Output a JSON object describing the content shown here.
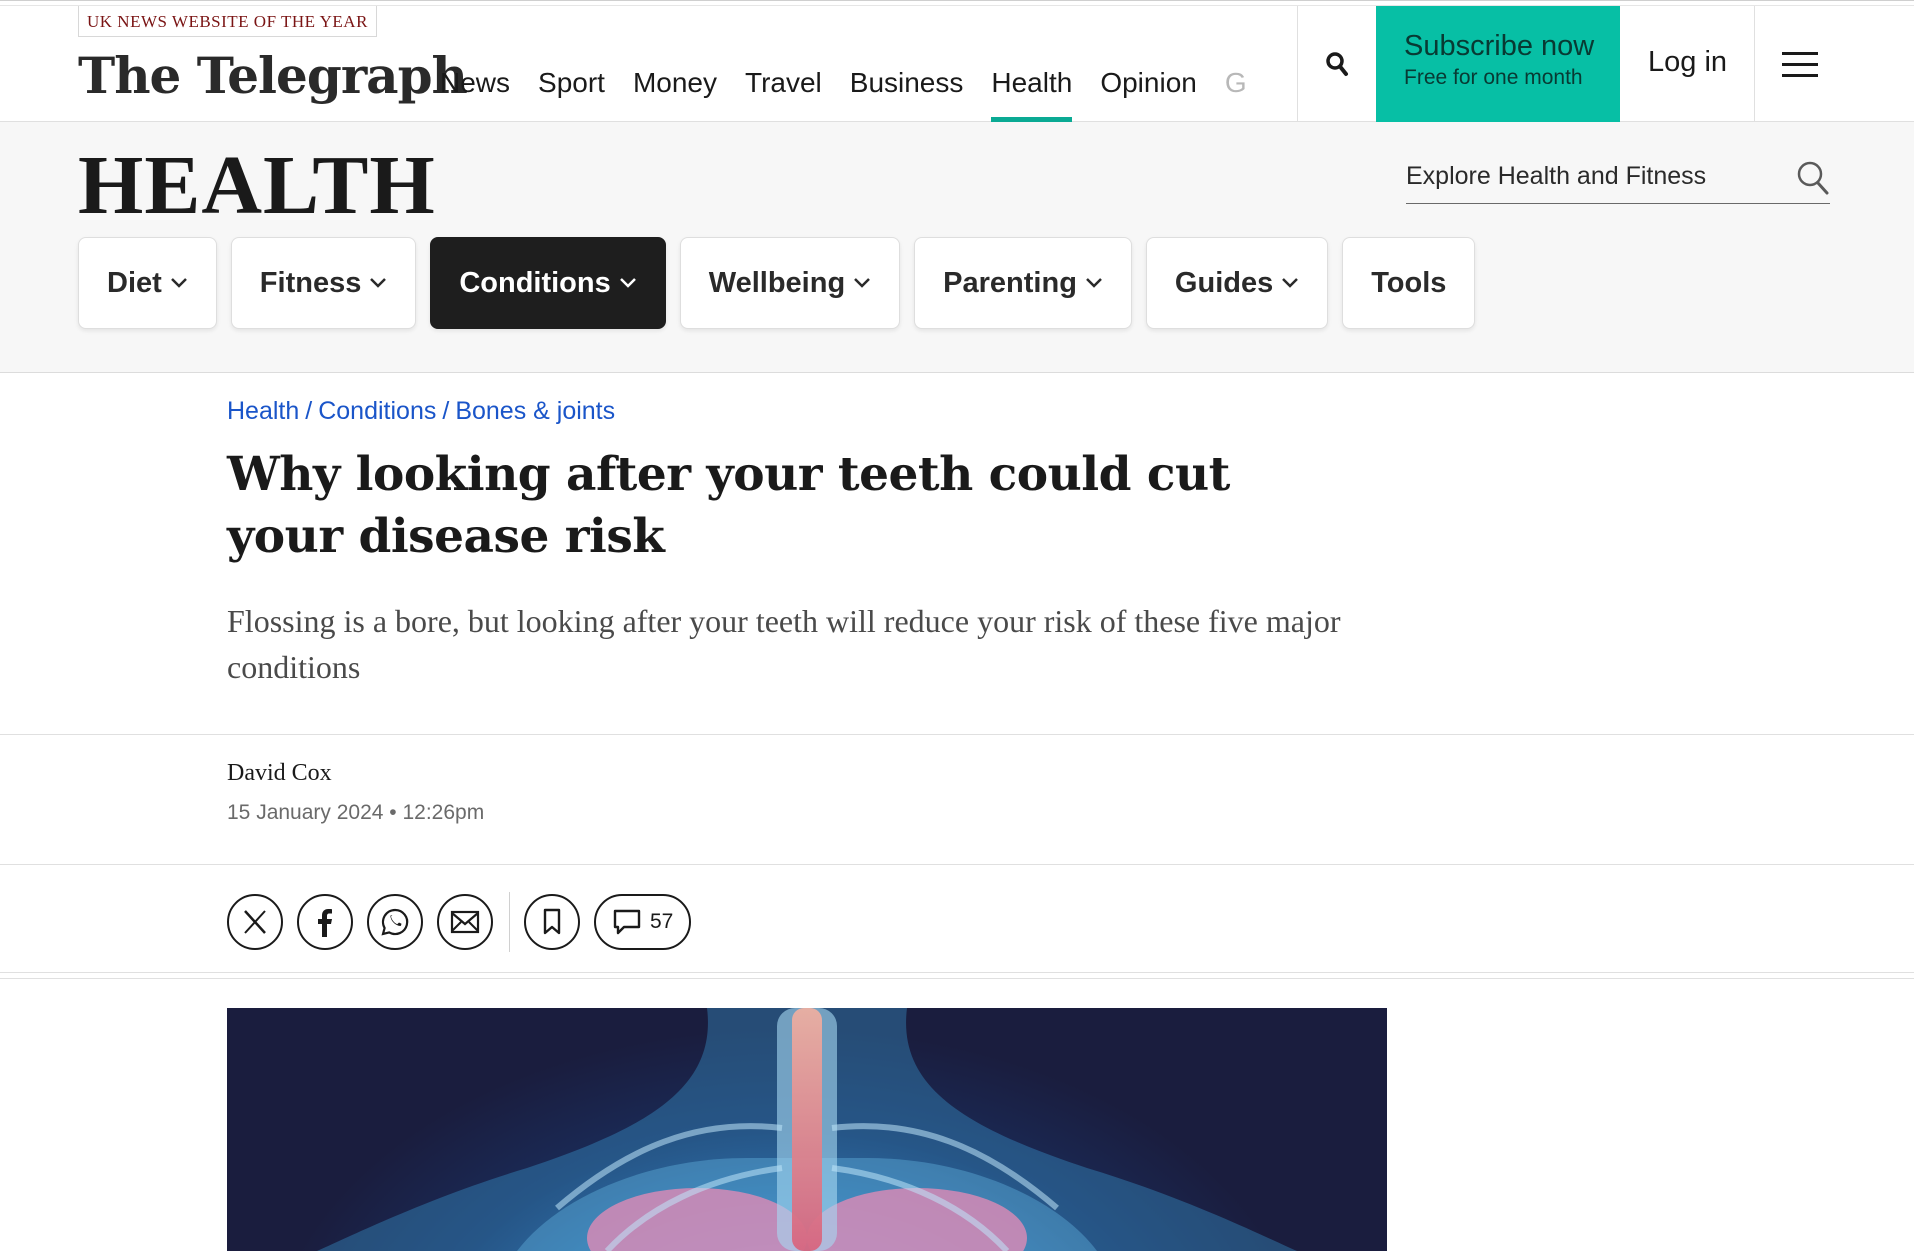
{
  "header": {
    "award": "UK NEWS WEBSITE OF THE YEAR",
    "logo": "The Telegraph",
    "nav": [
      {
        "label": "News"
      },
      {
        "label": "Sport"
      },
      {
        "label": "Money"
      },
      {
        "label": "Travel"
      },
      {
        "label": "Business"
      },
      {
        "label": "Health",
        "active": true
      },
      {
        "label": "Opinion"
      },
      {
        "label": "G",
        "faded": true
      }
    ],
    "subscribe": {
      "title": "Subscribe now",
      "subtitle": "Free for one month"
    },
    "login": "Log in",
    "icons": {
      "search": "search-icon",
      "menu": "hamburger-menu-icon"
    },
    "colors": {
      "subscribe_bg": "#07bfa5",
      "active_underline": "#0aaa94"
    }
  },
  "section": {
    "title": "HEALTH",
    "search_placeholder": "Explore Health and Fitness",
    "pills": [
      {
        "label": "Diet",
        "dropdown": true
      },
      {
        "label": "Fitness",
        "dropdown": true
      },
      {
        "label": "Conditions",
        "dropdown": true,
        "active": true
      },
      {
        "label": "Wellbeing",
        "dropdown": true
      },
      {
        "label": "Parenting",
        "dropdown": true
      },
      {
        "label": "Guides",
        "dropdown": true
      },
      {
        "label": "Tools",
        "dropdown": false
      }
    ]
  },
  "article": {
    "breadcrumb": [
      "Health",
      "Conditions",
      "Bones & joints"
    ],
    "breadcrumb_color": "#1a55c9",
    "headline": "Why looking after your teeth could cut your disease risk",
    "standfirst": "Flossing is a bore, but looking after your teeth will reduce your risk of these five major conditions",
    "author": "David Cox",
    "date": "15 January 2024 • 12:26pm",
    "share": {
      "icons": [
        "x-icon",
        "facebook-icon",
        "whatsapp-icon",
        "email-icon",
        "bookmark-icon",
        "comment-icon"
      ],
      "comment_count": "57"
    }
  }
}
